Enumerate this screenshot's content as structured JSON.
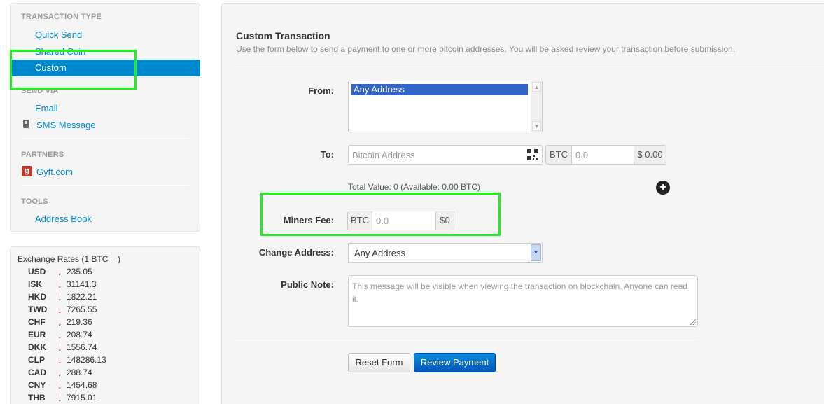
{
  "sidebar": {
    "transaction_type_header": "TRANSACTION TYPE",
    "quick_send": "Quick Send",
    "shared_coin": "Shared Coin",
    "custom": "Custom",
    "send_via_header": "SEND VIA",
    "email": "Email",
    "sms": "SMS Message",
    "partners_header": "PARTNERS",
    "gyft": "Gyft.com",
    "gyft_icon_letter": "g",
    "tools_header": "TOOLS",
    "address_book": "Address Book"
  },
  "rates": {
    "title": "Exchange Rates (1 BTC = )",
    "arrow": "🡇",
    "items": [
      {
        "code": "USD",
        "value": "235.05"
      },
      {
        "code": "ISK",
        "value": "31141.3"
      },
      {
        "code": "HKD",
        "value": "1822.21"
      },
      {
        "code": "TWD",
        "value": "7265.55"
      },
      {
        "code": "CHF",
        "value": "219.36"
      },
      {
        "code": "EUR",
        "value": "208.74"
      },
      {
        "code": "DKK",
        "value": "1556.74"
      },
      {
        "code": "CLP",
        "value": "148286.13"
      },
      {
        "code": "CAD",
        "value": "288.74"
      },
      {
        "code": "CNY",
        "value": "1454.68"
      },
      {
        "code": "THB",
        "value": "7915.01"
      }
    ]
  },
  "form": {
    "title": "Custom Transaction",
    "description": "Use the form below to send a payment to one or more bitcoin addresses. You will be asked review your transaction before submission.",
    "from_label": "From:",
    "from_selected": "Any Address",
    "to_label": "To:",
    "to_placeholder": "Bitcoin Address",
    "btc_addon": "BTC",
    "amount_placeholder": "0.0",
    "usd_to": "$ 0.00",
    "total_text": "Total Value: 0 (Available: 0.00 BTC)",
    "fee_label": "Miners Fee:",
    "fee_placeholder": "0.0",
    "usd_fee": "$0",
    "change_label": "Change Address:",
    "change_value": "Any Address",
    "note_label": "Public Note:",
    "note_placeholder": "This message will be visible when viewing the transaction on blockchain. Anyone can read it.",
    "reset_button": "Reset Form",
    "review_button": "Review Payment"
  },
  "colors": {
    "active_nav": "#0088cc",
    "link": "#0088cc",
    "annotation": "#22ee22",
    "primary_button": "#0055bb",
    "rate_down": "#8b1a1a"
  }
}
